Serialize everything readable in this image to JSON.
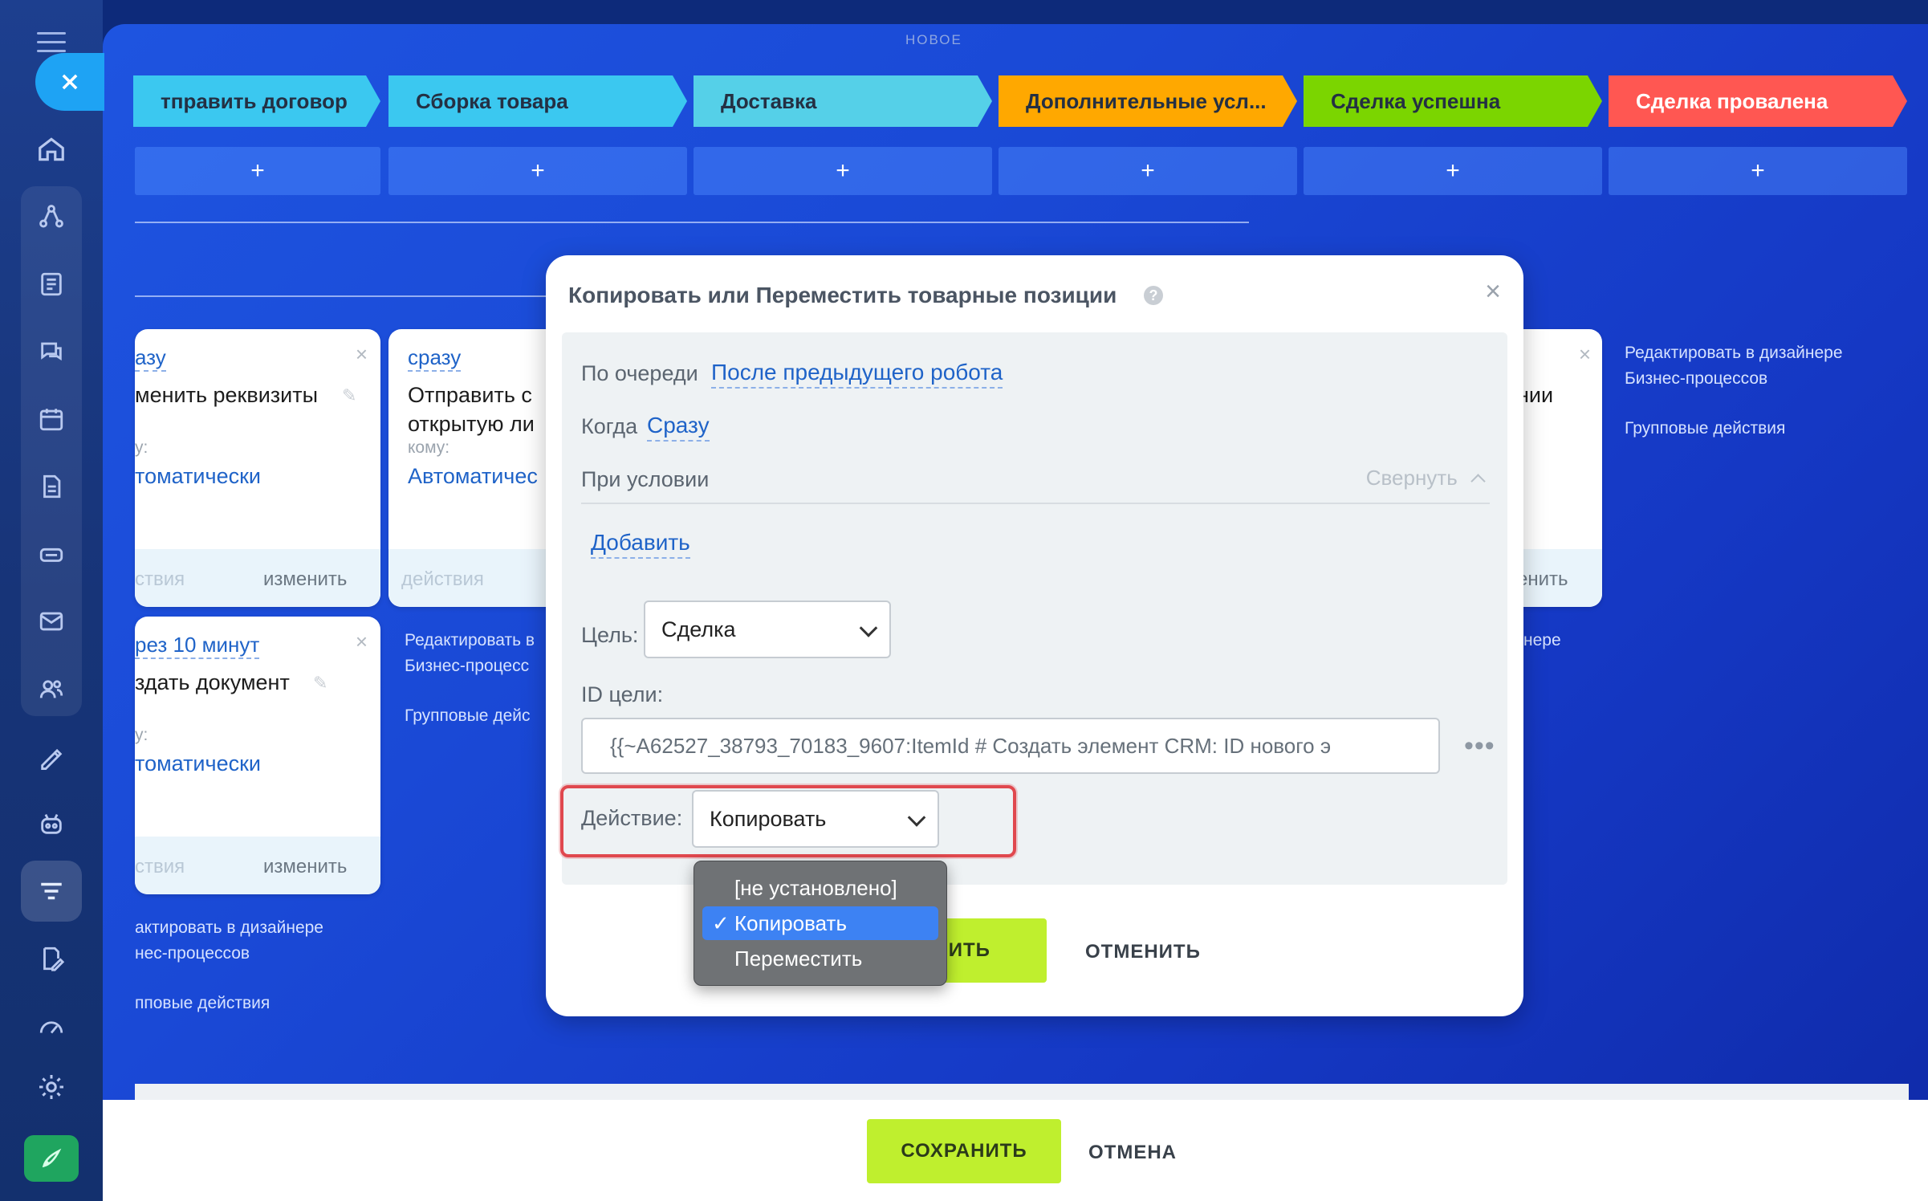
{
  "header": {
    "new_label": "НОВОЕ"
  },
  "stages": [
    {
      "label": "тправить договор",
      "color": "#3bc8f0"
    },
    {
      "label": "Сборка товара",
      "color": "#3bc8f0"
    },
    {
      "label": "Доставка",
      "color": "#55d0e8"
    },
    {
      "label": "Дополнительные усл...",
      "color": "#ffa800"
    },
    {
      "label": "Сделка успешна",
      "color": "#7bd500"
    },
    {
      "label": "Сделка провалена",
      "color": "#ff5752"
    }
  ],
  "add_symbol": "+",
  "cards": {
    "c1": {
      "timing": "азу",
      "title": "менить реквизиты",
      "to": "у:",
      "who": "томатически",
      "actions": "ствия",
      "edit": "изменить"
    },
    "c2": {
      "timing": "сразу",
      "title1": "Отправить с",
      "title2": "открытую ли",
      "to": "кому:",
      "who": "Автоматичес",
      "actions": "действия"
    },
    "c3": {
      "timing": "рез 10 минут",
      "title": "здать документ",
      "to": "у:",
      "who": "томатически",
      "actions": "ствия",
      "edit": "изменить"
    },
    "c4": {
      "title": "нии",
      "edit": "енить"
    }
  },
  "side_links": {
    "designer_full1": "Редактировать в дизайнере",
    "designer_full2": "Бизнес-процессов",
    "group_full": "Групповые действия",
    "designer_mid1": "Редактировать в",
    "designer_mid2": "Бизнес-процесс",
    "group_mid": "Групповые дейс",
    "designer_left1": "актировать в дизайнере",
    "designer_left2": "нес-процессов",
    "group_left": "пповые действия",
    "designer_right": "нере"
  },
  "dialog": {
    "title": "Копировать или Переместить товарные позиции",
    "help": "?",
    "close": "×",
    "queue_label": "По очереди",
    "queue_value": "После предыдущего робота",
    "when_label": "Когда",
    "when_value": "Сразу",
    "condition_label": "При условии",
    "collapse": "Свернуть",
    "add": "Добавить",
    "target_label": "Цель:",
    "target_value": "Сделка",
    "target_id_label": "ID цели:",
    "target_id_value": "{{~A62527_38793_70183_9607:ItemId # Создать элемент CRM: ID нового э",
    "more": "•••",
    "action_label": "Действие:",
    "action_value": "Копировать",
    "options": [
      "[не установлено]",
      "Копировать",
      "Переместить"
    ],
    "check": "✓",
    "save": "СОХРАНИТЬ",
    "save_visible": "РАНИТЬ",
    "cancel": "ОТМЕНИТЬ"
  },
  "footer": {
    "save": "СОХРАНИТЬ",
    "cancel": "ОТМЕНА"
  }
}
